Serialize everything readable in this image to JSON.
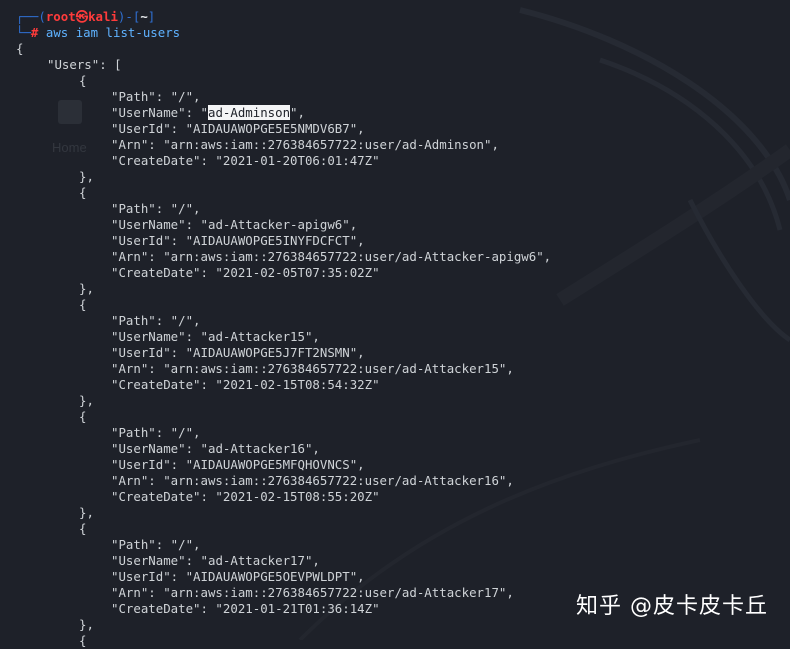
{
  "prompt": {
    "open": "┌──(",
    "user": "root",
    "at": "㉿",
    "host": "kali",
    "mid": ")-[",
    "cwd": "~",
    "close": "]",
    "corner": "└─",
    "hash": "#",
    "command": "aws iam list-users"
  },
  "background": {
    "home_label": "Home"
  },
  "json_output": {
    "open_brace": "{",
    "users_key": "\"Users\": [",
    "users": [
      {
        "open": "{",
        "path": "\"Path\": \"/\",",
        "username_prefix": "\"UserName\": \"",
        "username": "ad-Adminson",
        "username_suffix": "\",",
        "userid": "\"UserId\": \"AIDAUAWOPGE5E5NMDV6B7\",",
        "arn": "\"Arn\": \"arn:aws:iam::276384657722:user/ad-Adminson\",",
        "createdate": "\"CreateDate\": \"2021-01-20T06:01:47Z\"",
        "close": "},"
      },
      {
        "open": "{",
        "path": "\"Path\": \"/\",",
        "username_prefix": "\"UserName\": \"",
        "username": "ad-Attacker-apigw6",
        "username_suffix": "\",",
        "userid": "\"UserId\": \"AIDAUAWOPGE5INYFDCFCT\",",
        "arn": "\"Arn\": \"arn:aws:iam::276384657722:user/ad-Attacker-apigw6\",",
        "createdate": "\"CreateDate\": \"2021-02-05T07:35:02Z\"",
        "close": "},"
      },
      {
        "open": "{",
        "path": "\"Path\": \"/\",",
        "username_prefix": "\"UserName\": \"",
        "username": "ad-Attacker15",
        "username_suffix": "\",",
        "userid": "\"UserId\": \"AIDAUAWOPGE5J7FT2NSMN\",",
        "arn": "\"Arn\": \"arn:aws:iam::276384657722:user/ad-Attacker15\",",
        "createdate": "\"CreateDate\": \"2021-02-15T08:54:32Z\"",
        "close": "},"
      },
      {
        "open": "{",
        "path": "\"Path\": \"/\",",
        "username_prefix": "\"UserName\": \"",
        "username": "ad-Attacker16",
        "username_suffix": "\",",
        "userid": "\"UserId\": \"AIDAUAWOPGE5MFQHOVNCS\",",
        "arn": "\"Arn\": \"arn:aws:iam::276384657722:user/ad-Attacker16\",",
        "createdate": "\"CreateDate\": \"2021-02-15T08:55:20Z\"",
        "close": "},"
      },
      {
        "open": "{",
        "path": "\"Path\": \"/\",",
        "username_prefix": "\"UserName\": \"",
        "username": "ad-Attacker17",
        "username_suffix": "\",",
        "userid": "\"UserId\": \"AIDAUAWOPGE5OEVPWLDPT\",",
        "arn": "\"Arn\": \"arn:aws:iam::276384657722:user/ad-Attacker17\",",
        "createdate": "\"CreateDate\": \"2021-01-21T01:36:14Z\"",
        "close": "},"
      }
    ],
    "trailing_open": "{"
  },
  "watermark": "知乎 @皮卡皮卡丘",
  "colors": {
    "background": "#1e2129",
    "prompt_tree": "#2f6fd1",
    "prompt_user": "#ff3b3b",
    "command": "#5fb2ff",
    "text": "#cfd3d7",
    "selection": "#f4f5f6"
  }
}
